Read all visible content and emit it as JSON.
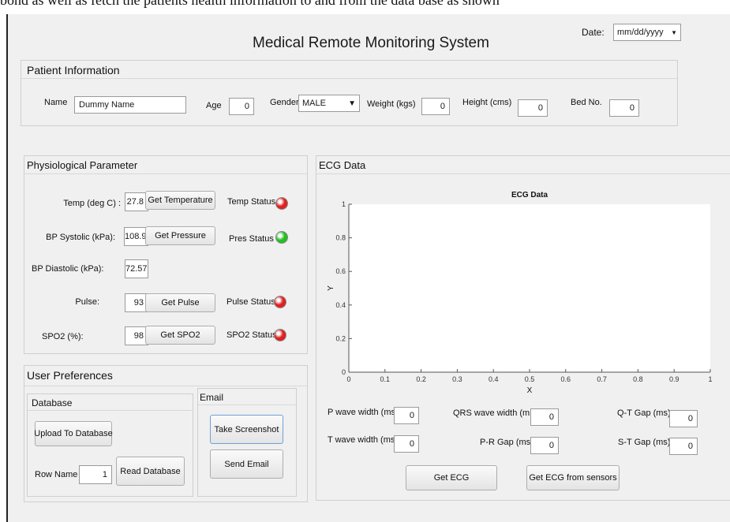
{
  "caption_fragment": "bond as well as fetch the patients health information to and from the data base as shown",
  "app_title": "Medical Remote Monitoring System",
  "date": {
    "label": "Date:",
    "value": "mm/dd/yyyy"
  },
  "patient": {
    "title": "Patient Information",
    "name_label": "Name",
    "name_value": "Dummy Name",
    "age_label": "Age",
    "age_value": "0",
    "gender_label": "Gender",
    "gender_value": "MALE",
    "weight_label": "Weight (kgs)",
    "weight_value": "0",
    "height_label": "Height (cms)",
    "height_value": "0",
    "bed_label": "Bed No.",
    "bed_value": "0"
  },
  "physio": {
    "title": "Physiological Parameter",
    "temp_label": "Temp (deg C) :",
    "temp_value": "27.8",
    "temp_button": "Get Temperature",
    "temp_status_label": "Temp Status",
    "bps_label": "BP Systolic (kPa):",
    "bps_value": "108.9",
    "bp_button": "Get Pressure",
    "pres_status_label": "Pres Status",
    "bpd_label": "BP Diastolic (kPa):",
    "bpd_value": "72.57",
    "pulse_label": "Pulse:",
    "pulse_value": "93",
    "pulse_button": "Get Pulse",
    "pulse_status_label": "Pulse Status",
    "spo2_label": "SPO2 (%):",
    "spo2_value": "98",
    "spo2_button": "Get SPO2",
    "spo2_status_label": "SPO2 Status"
  },
  "status_colors": {
    "temp": "#e02020",
    "pres": "#22c022",
    "pulse": "#e02020",
    "spo2": "#e02020"
  },
  "prefs": {
    "title": "User Preferences",
    "database_title": "Database",
    "upload_button": "Upload To Database",
    "row_name_label": "Row Name",
    "row_name_value": "1",
    "read_button": "Read Database",
    "email_title": "Email",
    "screenshot_button": "Take Screenshot",
    "send_email_button": "Send Email"
  },
  "ecg": {
    "title": "ECG Data",
    "p_wave_label": "P wave width (ms)",
    "p_wave_value": "0",
    "qrs_label": "QRS wave width (ms)",
    "qrs_value": "0",
    "qt_label": "Q-T Gap (ms)",
    "qt_value": "0",
    "t_wave_label": "T wave width (ms)",
    "t_wave_value": "0",
    "pr_label": "P-R Gap (ms)",
    "pr_value": "0",
    "st_label": "S-T Gap (ms)",
    "st_value": "0",
    "get_ecg_button": "Get ECG",
    "get_ecg_sensors_button": "Get ECG from sensors"
  },
  "chart_data": {
    "type": "line",
    "title": "ECG Data",
    "xlabel": "X",
    "ylabel": "Y",
    "xlim": [
      0,
      1
    ],
    "ylim": [
      0,
      1
    ],
    "x_ticks": [
      "0",
      "0.1",
      "0.2",
      "0.3",
      "0.4",
      "0.5",
      "0.6",
      "0.7",
      "0.8",
      "0.9",
      "1"
    ],
    "y_ticks": [
      "0",
      "0.2",
      "0.4",
      "0.6",
      "0.8",
      "1"
    ],
    "series": [],
    "grid": false
  }
}
